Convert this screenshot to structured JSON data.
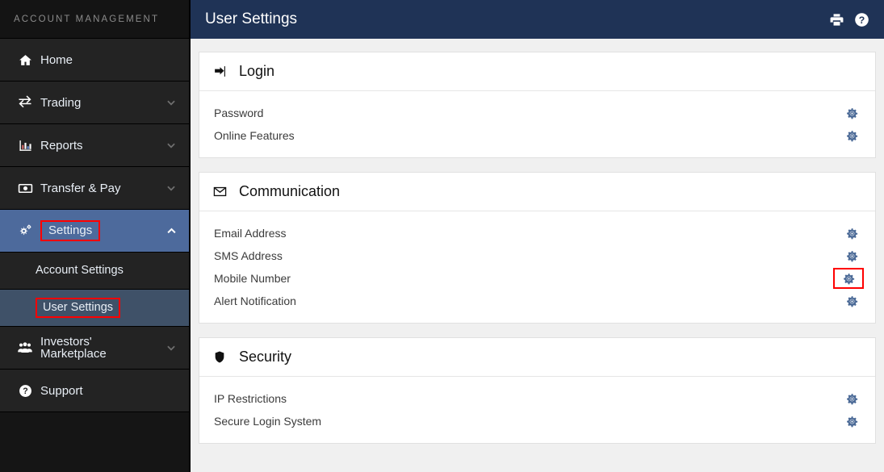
{
  "sidebar": {
    "brand": "ACCOUNT MANAGEMENT",
    "items": [
      {
        "label": "Home",
        "icon": "home-icon",
        "chevron": "",
        "active": false
      },
      {
        "label": "Trading",
        "icon": "exchange-icon",
        "chevron": "chevron-down",
        "active": false
      },
      {
        "label": "Reports",
        "icon": "bar-chart-icon",
        "chevron": "chevron-down",
        "active": false
      },
      {
        "label": "Transfer & Pay",
        "icon": "banknote-icon",
        "chevron": "chevron-down",
        "active": false
      },
      {
        "label": "Settings",
        "icon": "gears-icon",
        "chevron": "chevron-up",
        "active": true
      },
      {
        "label": "Investors' Marketplace",
        "icon": "people-group-icon",
        "chevron": "chevron-down",
        "active": false
      },
      {
        "label": "Support",
        "icon": "question-circle-icon",
        "chevron": "",
        "active": false
      }
    ],
    "sub_items": [
      {
        "label": "Account Settings",
        "active": false
      },
      {
        "label": "User Settings",
        "active": true
      }
    ],
    "highlight_color": "#ff0000"
  },
  "topbar": {
    "title": "User Settings",
    "print_icon": "printer-icon",
    "help_icon": "question-circle-icon"
  },
  "cards": [
    {
      "title": "Login",
      "icon": "sign-in-icon",
      "rows": [
        {
          "label": "Password",
          "gear": "gear-icon",
          "highlighted": false
        },
        {
          "label": "Online Features",
          "gear": "gear-icon",
          "highlighted": false
        }
      ]
    },
    {
      "title": "Communication",
      "icon": "envelope-icon",
      "rows": [
        {
          "label": "Email Address",
          "gear": "gear-icon",
          "highlighted": false
        },
        {
          "label": "SMS Address",
          "gear": "gear-icon",
          "highlighted": false
        },
        {
          "label": "Mobile Number",
          "gear": "gear-icon",
          "highlighted": true
        },
        {
          "label": "Alert Notification",
          "gear": "gear-icon",
          "highlighted": false
        }
      ]
    },
    {
      "title": "Security",
      "icon": "shield-icon",
      "rows": [
        {
          "label": "IP Restrictions",
          "gear": "gear-icon",
          "highlighted": false
        },
        {
          "label": "Secure Login System",
          "gear": "gear-icon",
          "highlighted": false
        }
      ]
    }
  ],
  "colors": {
    "sidebar_bg": "#232323",
    "sidebar_active": "#4d6a9c",
    "sub_active": "#3f5168",
    "topbar_bg": "#1f3356",
    "gear": "#4a6996",
    "content_bg": "#f0f0f0",
    "highlight": "#ff0000"
  }
}
